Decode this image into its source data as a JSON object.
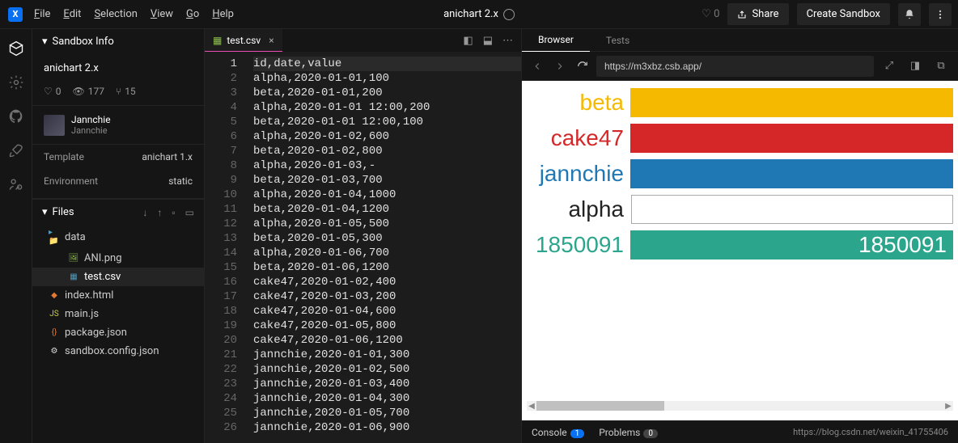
{
  "logo_letter": "X",
  "menu": {
    "file": "File",
    "edit": "Edit",
    "selection": "Selection",
    "view": "View",
    "go": "Go",
    "help": "Help"
  },
  "title": "anichart 2.x",
  "likes_top": "0",
  "share": "Share",
  "create": "Create Sandbox",
  "sidebar": {
    "info_title": "Sandbox Info",
    "project_name": "anichart 2.x",
    "stats": {
      "likes": "0",
      "views": "177",
      "forks": "15"
    },
    "author_name": "Jannchie",
    "author_sub": "Jannchie",
    "template_label": "Template",
    "template_value": "anichart 1.x",
    "env_label": "Environment",
    "env_value": "static",
    "files_title": "Files"
  },
  "files": [
    {
      "name": "data",
      "kind": "folder"
    },
    {
      "name": "ANI.png",
      "kind": "image",
      "indent": true
    },
    {
      "name": "test.csv",
      "kind": "csv",
      "indent": true,
      "selected": true
    },
    {
      "name": "index.html",
      "kind": "html"
    },
    {
      "name": "main.js",
      "kind": "js"
    },
    {
      "name": "package.json",
      "kind": "json"
    },
    {
      "name": "sandbox.config.json",
      "kind": "config"
    }
  ],
  "tab_name": "test.csv",
  "code_lines": [
    "id,date,value",
    "alpha,2020-01-01,100",
    "beta,2020-01-01,200",
    "alpha,2020-01-01 12:00,200",
    "beta,2020-01-01 12:00,100",
    "alpha,2020-01-02,600",
    "beta,2020-01-02,800",
    "alpha,2020-01-03,-",
    "beta,2020-01-03,700",
    "alpha,2020-01-04,1000",
    "beta,2020-01-04,1200",
    "alpha,2020-01-05,500",
    "beta,2020-01-05,300",
    "alpha,2020-01-06,700",
    "beta,2020-01-06,1200",
    "cake47,2020-01-02,400",
    "cake47,2020-01-03,200",
    "cake47,2020-01-04,600",
    "cake47,2020-01-05,800",
    "cake47,2020-01-06,1200",
    "jannchie,2020-01-01,300",
    "jannchie,2020-01-02,500",
    "jannchie,2020-01-03,400",
    "jannchie,2020-01-04,300",
    "jannchie,2020-01-05,700",
    "jannchie,2020-01-06,900"
  ],
  "preview": {
    "tab_browser": "Browser",
    "tab_tests": "Tests",
    "url": "https://m3xbz.csb.app/"
  },
  "chart_data": {
    "type": "bar",
    "orientation": "horizontal",
    "bars": [
      {
        "label": "beta",
        "value_text": "",
        "color": "#f5b900",
        "label_color": "#f5b900"
      },
      {
        "label": "cake47",
        "value_text": "",
        "color": "#d62728",
        "label_color": "#d62728"
      },
      {
        "label": "jannchie",
        "value_text": "",
        "color": "#1f77b4",
        "label_color": "#1f77b4"
      },
      {
        "label": "alpha",
        "value_text": "",
        "color": "#ffffff",
        "label_color": "#222",
        "border": true
      },
      {
        "label": "1850091",
        "value_text": "1850091",
        "color": "#2ca58d",
        "label_color": "#2ca58d"
      }
    ]
  },
  "bottombar": {
    "console": "Console",
    "console_count": "1",
    "problems": "Problems",
    "problems_count": "0",
    "watermark": "https://blog.csdn.net/weixin_41755406"
  }
}
